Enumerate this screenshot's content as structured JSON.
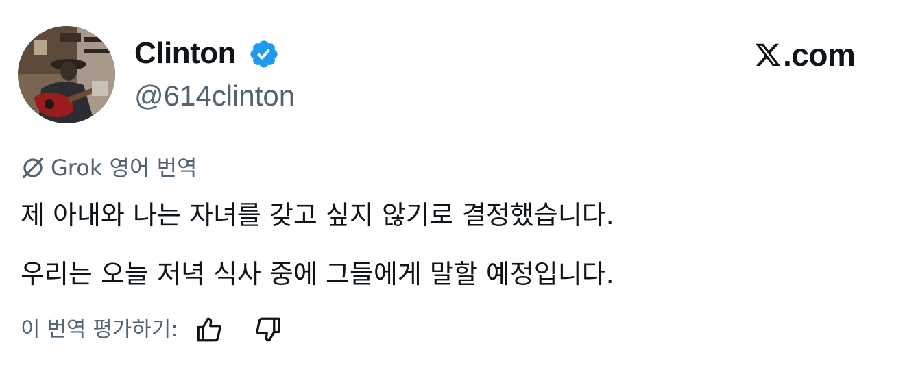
{
  "author": {
    "display_name": "Clinton",
    "handle": "@614clinton",
    "verified": true,
    "avatar": "profile-photo-man-playing-red-guitar"
  },
  "brand": {
    "logo": "x-logo-icon",
    "text": ".com"
  },
  "translation": {
    "label": "Grok 영어 번역",
    "icon": "grok-icon",
    "lines": [
      "제 아내와 나는 자녀를 갖고 싶지 않기로 결정했습니다.",
      "우리는 오늘 저녁 식사 중에 그들에게 말할 예정입니다."
    ],
    "rate_label": "이 번역 평가하기:",
    "rate_icons": [
      "thumbs-up-icon",
      "thumbs-down-icon"
    ]
  },
  "colors": {
    "text_primary": "#0f1419",
    "text_secondary": "#536471",
    "verified_blue": "#1d9bf0",
    "background": "#ffffff"
  }
}
